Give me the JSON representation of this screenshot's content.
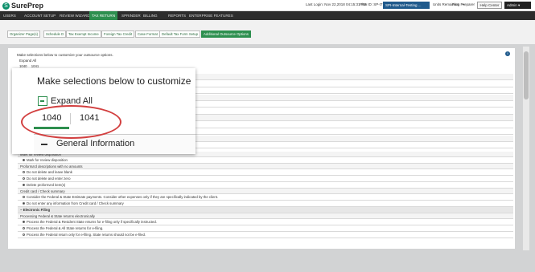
{
  "header": {
    "logo_mark": "S",
    "logo_text": "SurePrep",
    "last_login": "Last Login:  Nov 22,2018 04:15:31 PM",
    "firm_id": "Firm ID:  SP-t7",
    "firm_value": "SPI-Internal-Testing ...",
    "units_remaining": "Units Remaining",
    "role": "Pam Preparer",
    "help_center": "Help Center",
    "user": "Admin"
  },
  "nav": [
    "USERS",
    "ACCOUNT SETUP",
    "REVIEW WIZARD",
    "TAX RETURN",
    "SPRINDER",
    "BILLING",
    "REPORTS",
    "ENTERPRISE FEATURES"
  ],
  "nav_active": "TAX RETURN",
  "tabs": [
    "Organizer Page(s)",
    "Schedule D",
    "Tax Exempt Income",
    "Foreign Tax Credit",
    "Case Format",
    "Default Tax Form Setup",
    "Additional Outsource Options"
  ],
  "tabs_active": "Additional Outsource Options",
  "small": {
    "intro": "Make selections below to customize your outsource options.",
    "expand": "Expand All",
    "tab1": "1040",
    "tab2": "1041"
  },
  "rows": [
    {
      "kind": "sub",
      "text": "Mark for review disposition"
    },
    {
      "kind": "opt",
      "text": "Mark for review disposition",
      "radio": true,
      "checked": true
    },
    {
      "kind": "sub",
      "text": "Proforma'd descriptions with no amounts"
    },
    {
      "kind": "opt",
      "text": "Do not delete and leave blank",
      "radio": true,
      "checked": false
    },
    {
      "kind": "opt",
      "text": "Do not delete and enter zero",
      "radio": true,
      "checked": false
    },
    {
      "kind": "opt",
      "text": "Delete proforma'd item(s)",
      "radio": true,
      "checked": true
    },
    {
      "kind": "sub",
      "text": "Credit card / Check summary"
    },
    {
      "kind": "opt",
      "text": "Consider the Federal & State Estimate payments. Consider other expenses only if they are specifically indicated by the client.",
      "radio": true,
      "checked": false
    },
    {
      "kind": "opt",
      "text": "Do not enter any information from Credit card / Check summary",
      "radio": true,
      "checked": true
    },
    {
      "kind": "section",
      "text": "−  Electronic Filing"
    },
    {
      "kind": "sub",
      "text": "Processing Federal & State returns electronically"
    },
    {
      "kind": "opt",
      "text": "Process the Federal & Resident State returns for e-filing only if specifically instructed.",
      "radio": true,
      "checked": true
    },
    {
      "kind": "opt",
      "text": "Process the Federal & All State returns for e-filing.",
      "radio": true,
      "checked": false
    },
    {
      "kind": "opt",
      "text": "Process the Federal return only for e-filing. State returns should not be e-filed.",
      "radio": true,
      "checked": false
    }
  ],
  "zoom": {
    "intro": "Make selections below to customize",
    "expand": "Expand All",
    "tab1": "1040",
    "tab2": "1041",
    "general": "General Information"
  },
  "colors": {
    "accent": "#2e8f4f",
    "highlight_circle": "#d23f3f",
    "nav_bg": "#2d2d2d",
    "brand_blue": "#1f5a8c"
  },
  "icons": {
    "logo": "sureprep-logo-icon",
    "info": "info-icon",
    "expand": "expand-all-icon",
    "collapse": "minus-icon"
  }
}
